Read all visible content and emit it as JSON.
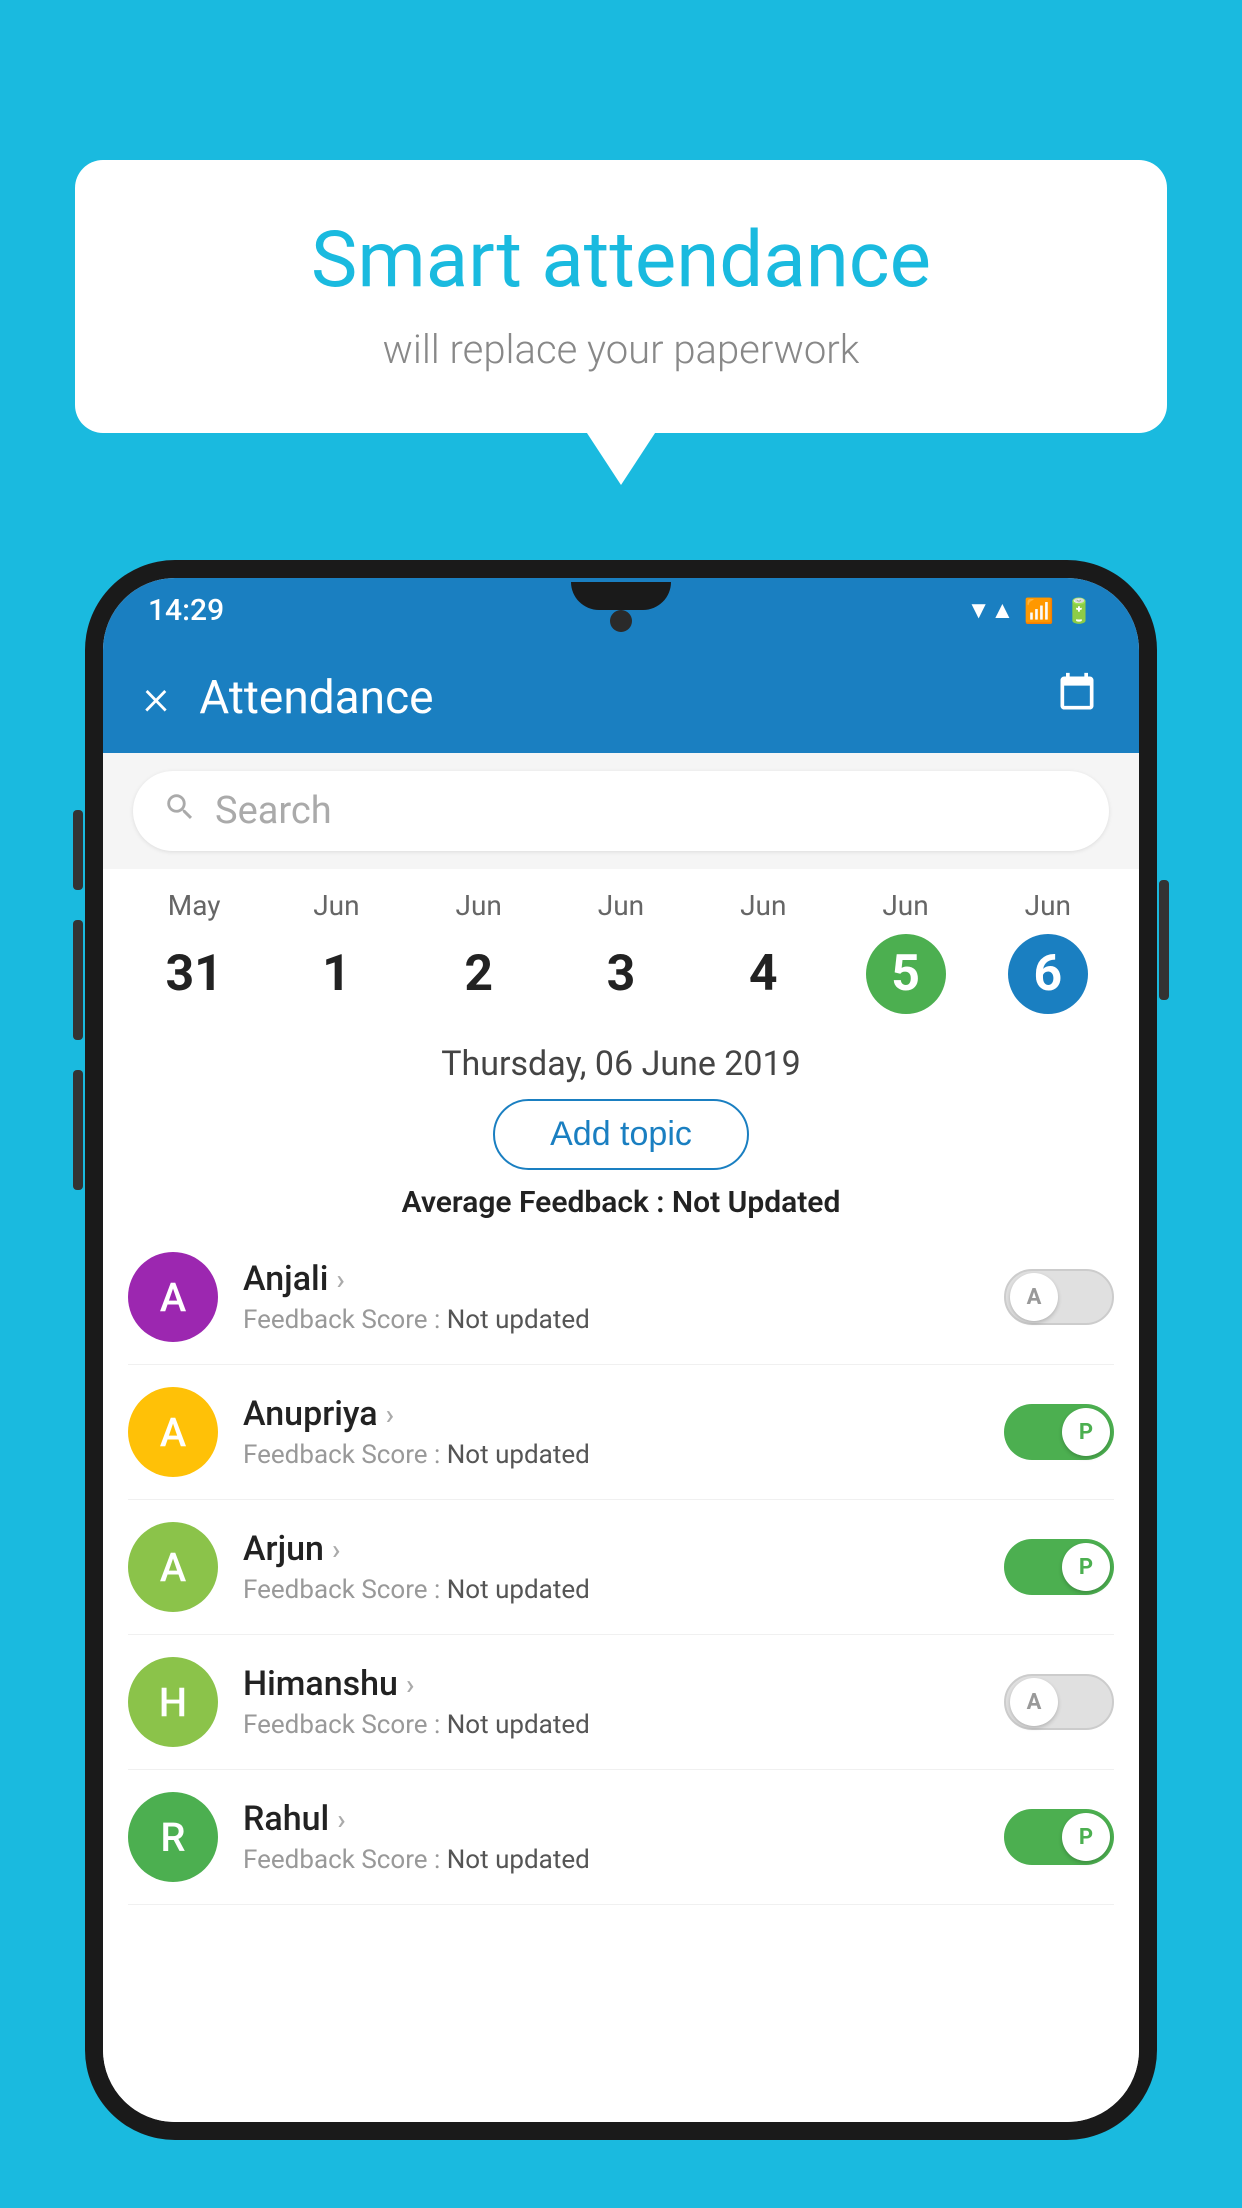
{
  "background": {
    "color": "#1ABADF"
  },
  "bubble": {
    "title": "Smart attendance",
    "subtitle": "will replace your paperwork"
  },
  "status_bar": {
    "time": "14:29",
    "icons": [
      "wifi",
      "signal",
      "battery"
    ]
  },
  "app_bar": {
    "title": "Attendance",
    "close_icon": "×",
    "calendar_icon": "📅"
  },
  "search": {
    "placeholder": "Search"
  },
  "calendar": {
    "days": [
      {
        "month": "May",
        "date": "31",
        "style": "normal"
      },
      {
        "month": "Jun",
        "date": "1",
        "style": "normal"
      },
      {
        "month": "Jun",
        "date": "2",
        "style": "normal"
      },
      {
        "month": "Jun",
        "date": "3",
        "style": "normal"
      },
      {
        "month": "Jun",
        "date": "4",
        "style": "normal"
      },
      {
        "month": "Jun",
        "date": "5",
        "style": "today"
      },
      {
        "month": "Jun",
        "date": "6",
        "style": "selected"
      }
    ]
  },
  "selected_date": "Thursday, 06 June 2019",
  "add_topic_label": "Add topic",
  "avg_feedback_label": "Average Feedback :",
  "avg_feedback_value": "Not Updated",
  "students": [
    {
      "name": "Anjali",
      "avatar_letter": "A",
      "avatar_color": "#9C27B0",
      "feedback": "Not updated",
      "attendance": "absent"
    },
    {
      "name": "Anupriya",
      "avatar_letter": "A",
      "avatar_color": "#FFC107",
      "feedback": "Not updated",
      "attendance": "present"
    },
    {
      "name": "Arjun",
      "avatar_letter": "A",
      "avatar_color": "#8BC34A",
      "feedback": "Not updated",
      "attendance": "present"
    },
    {
      "name": "Himanshu",
      "avatar_letter": "H",
      "avatar_color": "#8BC34A",
      "feedback": "Not updated",
      "attendance": "absent"
    },
    {
      "name": "Rahul",
      "avatar_letter": "R",
      "avatar_color": "#4CAF50",
      "feedback": "Not updated",
      "attendance": "present"
    }
  ],
  "toggle_labels": {
    "absent": "A",
    "present": "P"
  }
}
